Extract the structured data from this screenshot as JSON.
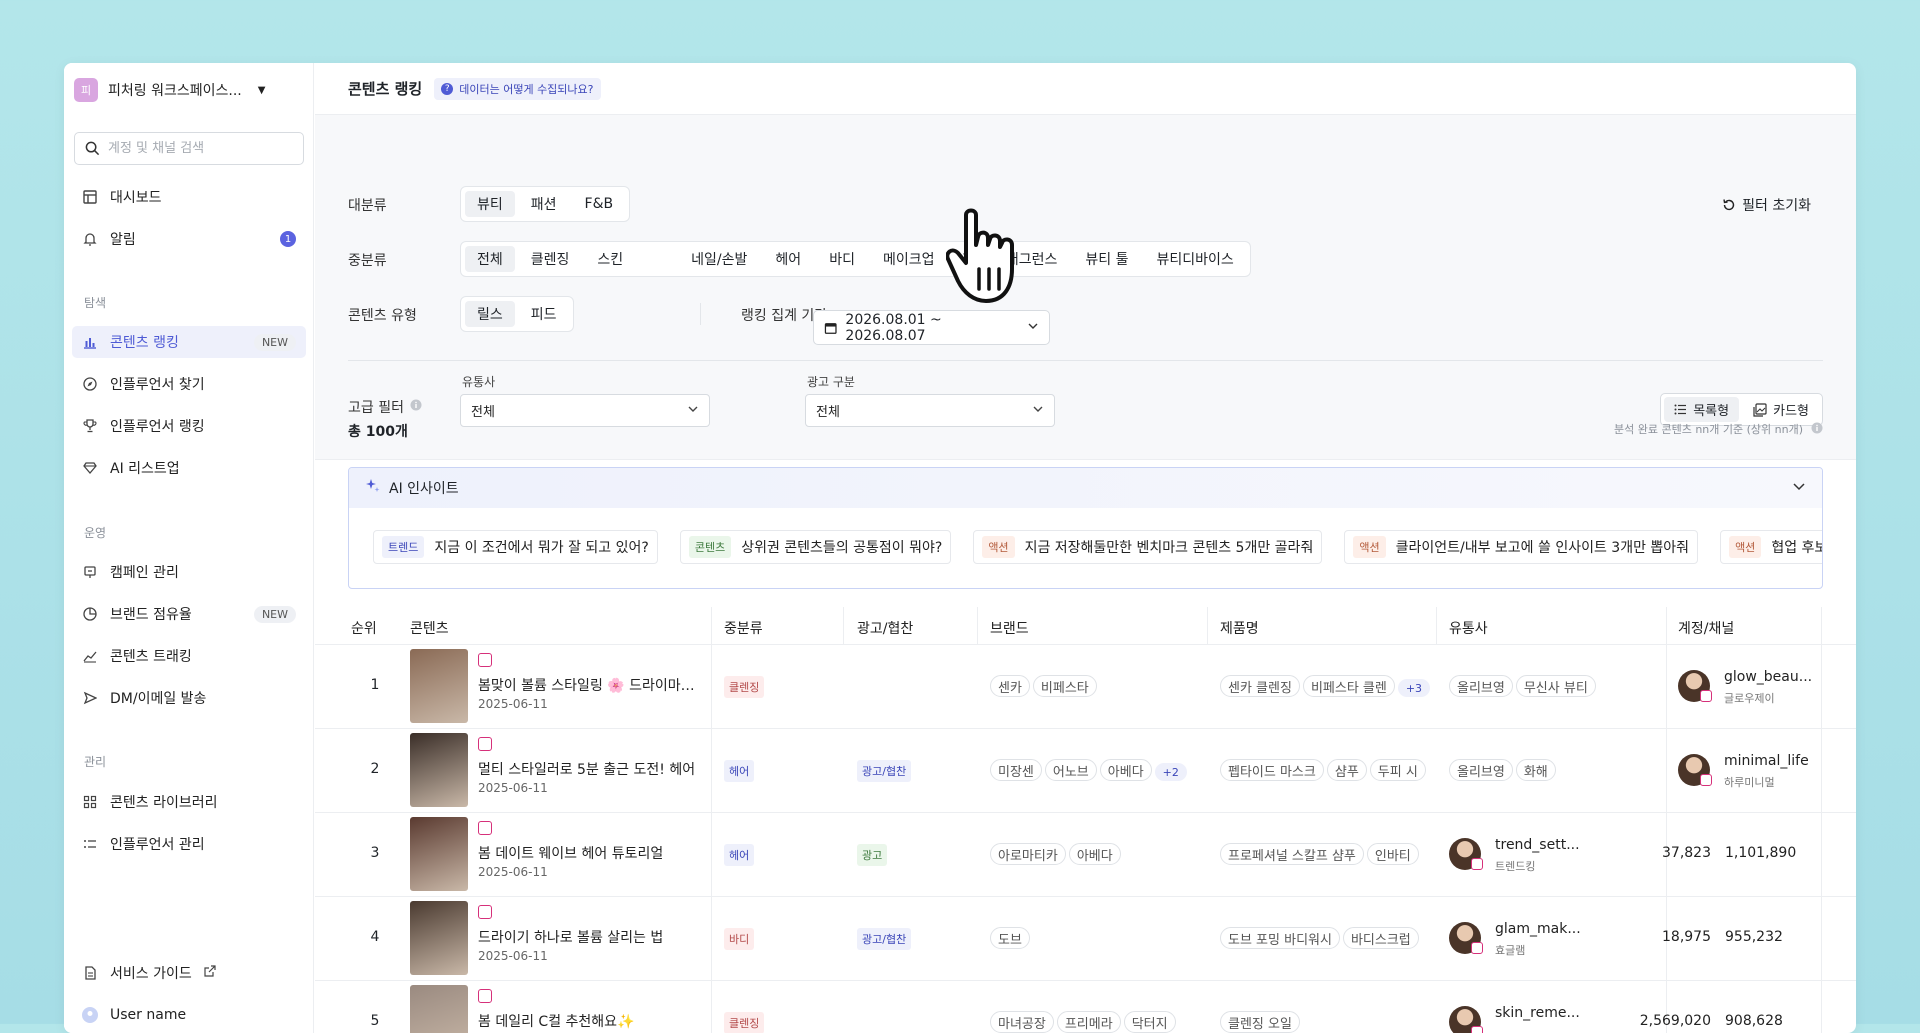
{
  "sidebar": {
    "workspace": {
      "avatar": "피",
      "name": "피처링 워크스페이스..."
    },
    "search": {
      "placeholder": "계정 및 채널 검색"
    },
    "items": [
      {
        "label": "대시보드",
        "icon": "dashboard-icon"
      },
      {
        "label": "알림",
        "icon": "bell-icon",
        "count": "1"
      }
    ],
    "sections": [
      {
        "label": "탐색",
        "items": [
          {
            "label": "콘텐츠 랭킹",
            "icon": "chart-icon",
            "badge": "NEW",
            "active": true
          },
          {
            "label": "인플루언서 찾기",
            "icon": "compass-icon"
          },
          {
            "label": "인플루언서 랭킹",
            "icon": "trophy-icon"
          },
          {
            "label": "AI 리스트업",
            "icon": "diamond-icon"
          }
        ]
      },
      {
        "label": "운영",
        "items": [
          {
            "label": "캠페인 관리",
            "icon": "campaign-icon"
          },
          {
            "label": "브랜드 점유율",
            "icon": "pie-icon",
            "badge": "NEW"
          },
          {
            "label": "콘텐츠 트래킹",
            "icon": "tracking-icon"
          },
          {
            "label": "DM/이메일 발송",
            "icon": "send-icon"
          }
        ]
      },
      {
        "label": "관리",
        "items": [
          {
            "label": "콘텐츠 라이브러리",
            "icon": "grid-icon"
          },
          {
            "label": "인플루언서 관리",
            "icon": "list-icon"
          }
        ]
      }
    ],
    "footer": {
      "guide": "서비스 가이드",
      "user": "User name"
    }
  },
  "header": {
    "title": "콘텐츠 랭킹",
    "help": "데이터는 어떻게 수집되나요?"
  },
  "filters": {
    "category": {
      "label": "대분류",
      "options": [
        "뷰티",
        "패션",
        "F&B"
      ],
      "selected": "뷰티"
    },
    "subcategory": {
      "label": "중분류",
      "options": [
        "전체",
        "클렌징",
        "스킨",
        "네일/손발",
        "헤어",
        "바디",
        "메이크업",
        "향수/프래그런스",
        "뷰티 툴",
        "뷰티디바이스"
      ],
      "selected": "전체"
    },
    "content_type": {
      "label": "콘텐츠 유형",
      "options": [
        "릴스",
        "피드"
      ],
      "selected": "릴스"
    },
    "period": {
      "label": "랭킹 집계 기간",
      "value": "2026.08.01 ~ 2026.08.07"
    },
    "reset": "필터 초기화",
    "advanced": {
      "label": "고급 필터",
      "retailer_label": "유통사",
      "retailer_value": "전체",
      "ad_label": "광고 구분",
      "ad_value": "전체"
    },
    "view": {
      "list": "목록형",
      "card": "카드형",
      "selected": "list"
    }
  },
  "summary": {
    "total": "총 100개",
    "note": "분석 완료 콘텐츠 nn개 기준 (상위 nn개)"
  },
  "ai_insight": {
    "title": "AI 인사이트",
    "chips": [
      {
        "tag": "트렌드",
        "kind": "trend",
        "text": "지금 이 조건에서 뭐가 잘 되고 있어?"
      },
      {
        "tag": "콘텐츠",
        "kind": "content",
        "text": "상위권 콘텐츠들의 공통점이 뭐야?"
      },
      {
        "tag": "액션",
        "kind": "action",
        "text": "지금 저장해둘만한 벤치마크 콘텐츠 5개만 골라줘"
      },
      {
        "tag": "액션",
        "kind": "action",
        "text": "클라이언트/내부 보고에 쓸 인사이트 3개만 뽑아줘"
      },
      {
        "tag": "액션",
        "kind": "action",
        "text": "협업 후보로 검"
      }
    ]
  },
  "table": {
    "headers": [
      "순위",
      "콘텐츠",
      "중분류",
      "광고/협찬",
      "브랜드",
      "제품명",
      "유통사",
      "계정/채널"
    ],
    "rows": [
      {
        "rank": "1",
        "title": "봄맞이 볼륨 스타일링 🌸 드라이마느...",
        "date": "2025-06-11",
        "sub": "클렌징",
        "sub_kind": "red",
        "ad": "",
        "brands": [
          "센카",
          "비페스타"
        ],
        "brands_more": "",
        "products": [
          "센카 클렌징",
          "비페스타 클렌"
        ],
        "products_more": "+3",
        "retailers": [
          "올리브영",
          "무신사 뷰티"
        ],
        "account": "glow_beau...",
        "account_sub": "글로우제이",
        "followers": "",
        "views": "",
        "thumb": "#8a6a55"
      },
      {
        "rank": "2",
        "title": "멀티 스타일러로 5분 출근 도전! 헤어",
        "date": "2025-06-11",
        "sub": "헤어",
        "sub_kind": "blue",
        "ad": "광고/협찬",
        "ad_kind": "blue",
        "brands": [
          "미장센",
          "어노브",
          "아베다"
        ],
        "brands_more": "+2",
        "products": [
          "펩타이드 마스크",
          "샴푸",
          "두피 시"
        ],
        "products_more": "",
        "retailers": [
          "올리브영",
          "화해"
        ],
        "account": "minimal_life",
        "account_sub": "하루미니멀",
        "followers": "",
        "views": "",
        "thumb": "#3a2e28"
      },
      {
        "rank": "3",
        "title": "봄 데이트 웨이브 헤어 튜토리얼",
        "date": "2025-06-11",
        "sub": "헤어",
        "sub_kind": "blue",
        "ad": "광고",
        "ad_kind": "green",
        "brands": [
          "아로마티카",
          "아베다"
        ],
        "brands_more": "",
        "products": [
          "프로페셔널 스칼프 샴푸",
          "인바티"
        ],
        "products_more": "",
        "retailers": [],
        "account": "trend_sett...",
        "account_sub": "트렌드킹",
        "followers": "37,823",
        "views": "1,101,890",
        "thumb": "#5a3a30"
      },
      {
        "rank": "4",
        "title": "드라이기 하나로 볼륨 살리는 법",
        "date": "2025-06-11",
        "sub": "바디",
        "sub_kind": "red",
        "ad": "광고/협찬",
        "ad_kind": "blue",
        "brands": [
          "도브"
        ],
        "brands_more": "",
        "products": [
          "도브 포밍 바디워시",
          "바디스크럽"
        ],
        "products_more": "",
        "retailers": [],
        "account": "glam_mak...",
        "account_sub": "효글램",
        "followers": "18,975",
        "views": "955,232",
        "thumb": "#4a3a30"
      },
      {
        "rank": "5",
        "title": "봄 데일리 C컬 추천해요✨",
        "date": "2025-06-11",
        "sub": "클렌징",
        "sub_kind": "red",
        "ad": "",
        "brands": [
          "마녀공장",
          "프리메라",
          "닥터지"
        ],
        "brands_more": "",
        "products": [
          "클렌징 오일"
        ],
        "products_more": "",
        "retailers": [],
        "account": "skin_reme...",
        "account_sub": "",
        "followers": "2,569,020",
        "views": "908,628",
        "thumb": "#9a8a80"
      }
    ]
  },
  "colors": {
    "accent": "#4f5bd5",
    "background": "#b3e6ea"
  }
}
